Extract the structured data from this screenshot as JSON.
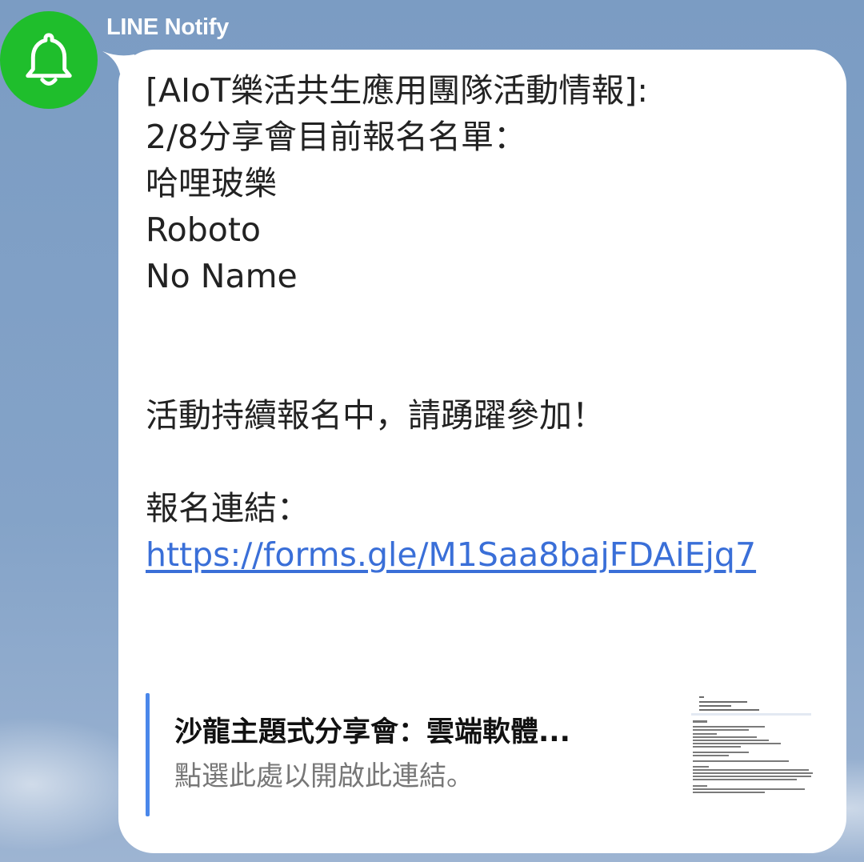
{
  "chat": {
    "sender_name": "LINE Notify",
    "avatar_icon": "bell-icon",
    "avatar_color": "#1fbe2c"
  },
  "message": {
    "line1": "[AIoT樂活共生應用團隊活動情報]:",
    "line2": "2/8分享會目前報名名單：",
    "attendees": [
      "哈哩玻樂",
      "Roboto",
      "No Name"
    ],
    "status": "活動持續報名中，請踴躍參加！",
    "link_label": "報名連結：",
    "link_url": "https://forms.gle/M1Saa8bajFDAiEjq7",
    "link_color": "#3a6fd8"
  },
  "link_preview": {
    "title": "沙龍主題式分享會：雲端軟體...",
    "subtitle": "點選此處以開啟此連結。",
    "bar_color": "#4a87ea"
  }
}
